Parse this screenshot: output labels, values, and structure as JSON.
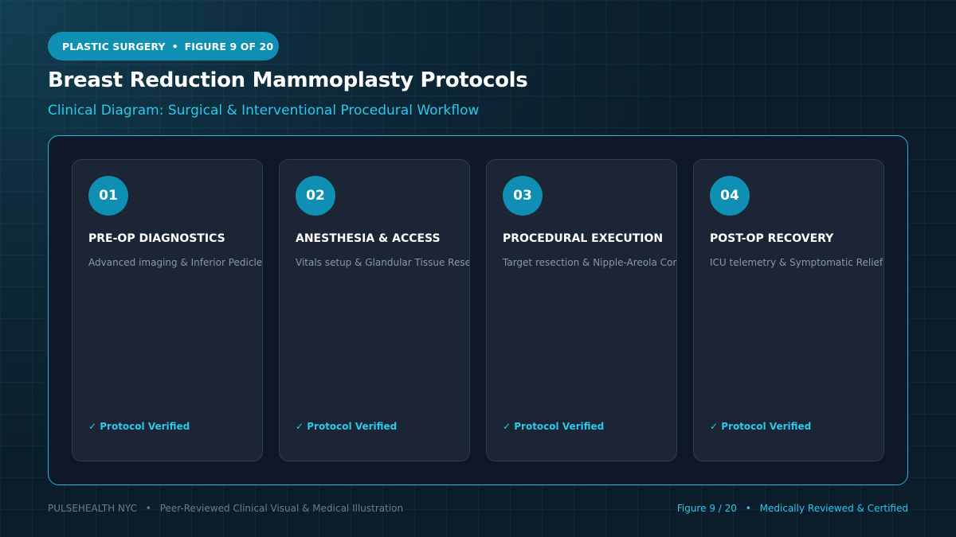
{
  "header": {
    "category": "PLASTIC SURGERY",
    "figure_label": "FIGURE 9 OF 20",
    "separator": "•",
    "title": "Breast Reduction Mammoplasty Protocols",
    "subtitle": "Clinical Diagram: Surgical & Interventional Procedural Workflow"
  },
  "steps": [
    {
      "number": "01",
      "title": "PRE-OP DIAGNOSTICS",
      "description": "Advanced imaging & Inferior Pedicle Technique",
      "status": "✓ Protocol Verified"
    },
    {
      "number": "02",
      "title": "ANESTHESIA & ACCESS",
      "description": "Vitals setup & Glandular Tissue Resection",
      "status": "✓ Protocol Verified"
    },
    {
      "number": "03",
      "title": "PROCEDURAL EXECUTION",
      "description": "Target resection & Nipple-Areola Complex Transposition",
      "status": "✓ Protocol Verified"
    },
    {
      "number": "04",
      "title": "POST-OP RECOVERY",
      "description": "ICU telemetry & Symptomatic Relief Index",
      "status": "✓ Protocol Verified"
    }
  ],
  "footer": {
    "brand": "PULSEHEALTH NYC",
    "separator": "•",
    "tagline": "Peer-Reviewed Clinical Visual & Medical Illustration",
    "figure": "Figure 9 / 20",
    "certification": "Medically Reviewed & Certified"
  },
  "colors": {
    "accent": "#0e8fb3",
    "highlight": "#2cc8ea",
    "background": "#0b1d2b",
    "card": "#1b2536"
  }
}
